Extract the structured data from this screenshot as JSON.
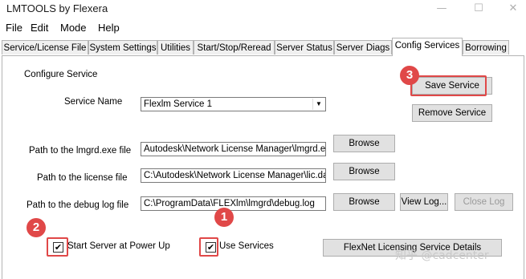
{
  "window": {
    "title": "LMTOOLS by Flexera",
    "minimize": "—",
    "maximize": "☐",
    "close": "✕"
  },
  "menu": [
    "File",
    "Edit",
    "Mode",
    "Help"
  ],
  "tabs": [
    "Service/License File",
    "System Settings",
    "Utilities",
    "Start/Stop/Reread",
    "Server Status",
    "Server Diags",
    "Config Services",
    "Borrowing"
  ],
  "active_tab": "Config Services",
  "config": {
    "section_label": "Configure Service",
    "service_name_label": "Service Name",
    "service_name_value": "Flexlm Service 1",
    "lmgrd_label": "Path to the lmgrd.exe file",
    "lmgrd_value": "Autodesk\\Network License Manager\\lmgrd.exe",
    "license_label": "Path to the license file",
    "license_value": "C:\\Autodesk\\Network License Manager\\lic.dat",
    "debug_label": "Path to the debug log file",
    "debug_value": "C:\\ProgramData\\FLEXlm\\lmgrd\\debug.log",
    "save_label": "Save Service",
    "remove_label": "Remove Service",
    "browse_label": "Browse",
    "view_log_label": "View Log...",
    "close_log_label": "Close Log",
    "start_at_powerup_label": "Start Server at Power Up",
    "start_at_powerup_checked": true,
    "use_services_label": "Use Services",
    "use_services_checked": true,
    "flexnet_details_label": "FlexNet Licensing Service Details"
  },
  "annotations": {
    "badge1": "1",
    "badge2": "2",
    "badge3": "3",
    "highlight_color": "#e04848"
  },
  "watermark": "知乎 @cadcenter"
}
